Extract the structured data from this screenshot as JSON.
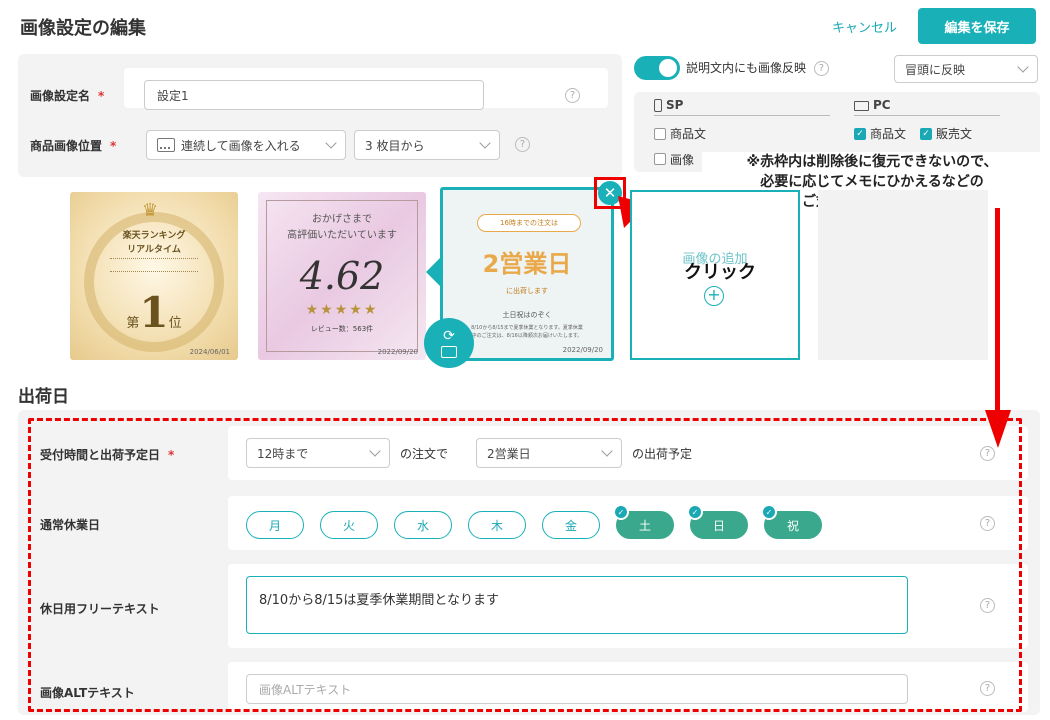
{
  "header": {
    "title": "画像設定の編集",
    "cancel": "キャンセル",
    "save": "編集を保存"
  },
  "form": {
    "name_label": "画像設定名",
    "name_value": "設定1",
    "position_label": "商品画像位置",
    "position_select": "連続して画像を入れる",
    "position_start": "3 枚目から",
    "required_mark": "*",
    "help": "?"
  },
  "reflect": {
    "toggle_label": "説明文内にも画像反映",
    "toggle_on": true,
    "select": "冒頭に反映",
    "sp": {
      "title": "SP",
      "items": [
        {
          "label": "商品文",
          "checked": false
        },
        {
          "label": "画像",
          "checked": false
        }
      ]
    },
    "pc": {
      "title": "PC",
      "items": [
        {
          "label": "商品文",
          "checked": true
        },
        {
          "label": "販売文",
          "checked": true
        }
      ]
    }
  },
  "note": {
    "lines": [
      "※赤枠内は削除後に復元できないので、",
      "必要に応じてメモにひかえるなどの",
      "ご対応をお願いします"
    ]
  },
  "click_label": "クリック",
  "thumbnails": [
    {
      "title": "楽天ランキング",
      "subtitle": "リアルタイム",
      "rank_prefix": "第",
      "rank": "1",
      "rank_suffix": "位",
      "date": "2024/06/01"
    },
    {
      "line1": "おかげさまで",
      "line2": "高評価いただいています",
      "score": "4.62",
      "stars": "★★★★★",
      "reviews": "レビュー数：563件",
      "date": "2022/09/20"
    },
    {
      "badge": "16時までの注文は",
      "main": "2営業日",
      "sub": "に出荷します",
      "note": "土日祝はのぞく",
      "detail1": "8/10から8/15まで夏季休業となります。夏季休業",
      "detail2": "中のご注文は、8/16以降順次お届けいたします。",
      "date": "2022/09/20"
    }
  ],
  "add_image": {
    "label": "画像の追加",
    "plus": "+"
  },
  "shipping": {
    "section_title": "出荷日",
    "reception_label": "受付時間と出荷予定日",
    "time_select": "12時まで",
    "order_text": "の注文で",
    "days_select": "2営業日",
    "ship_text": "の出荷予定",
    "holidays_label": "通常休業日",
    "days": [
      {
        "label": "月",
        "on": false
      },
      {
        "label": "火",
        "on": false
      },
      {
        "label": "水",
        "on": false
      },
      {
        "label": "木",
        "on": false
      },
      {
        "label": "金",
        "on": false
      },
      {
        "label": "土",
        "on": true
      },
      {
        "label": "日",
        "on": true
      },
      {
        "label": "祝",
        "on": true
      }
    ],
    "free_text_label": "休日用フリーテキスト",
    "free_text_value": "8/10から8/15は夏季休業期間となります",
    "alt_label": "画像ALTテキスト",
    "alt_placeholder": "画像ALTテキスト"
  },
  "colors": {
    "accent": "#1ab0b8",
    "active_day": "#3aa88c",
    "annotation": "#ee0000"
  }
}
